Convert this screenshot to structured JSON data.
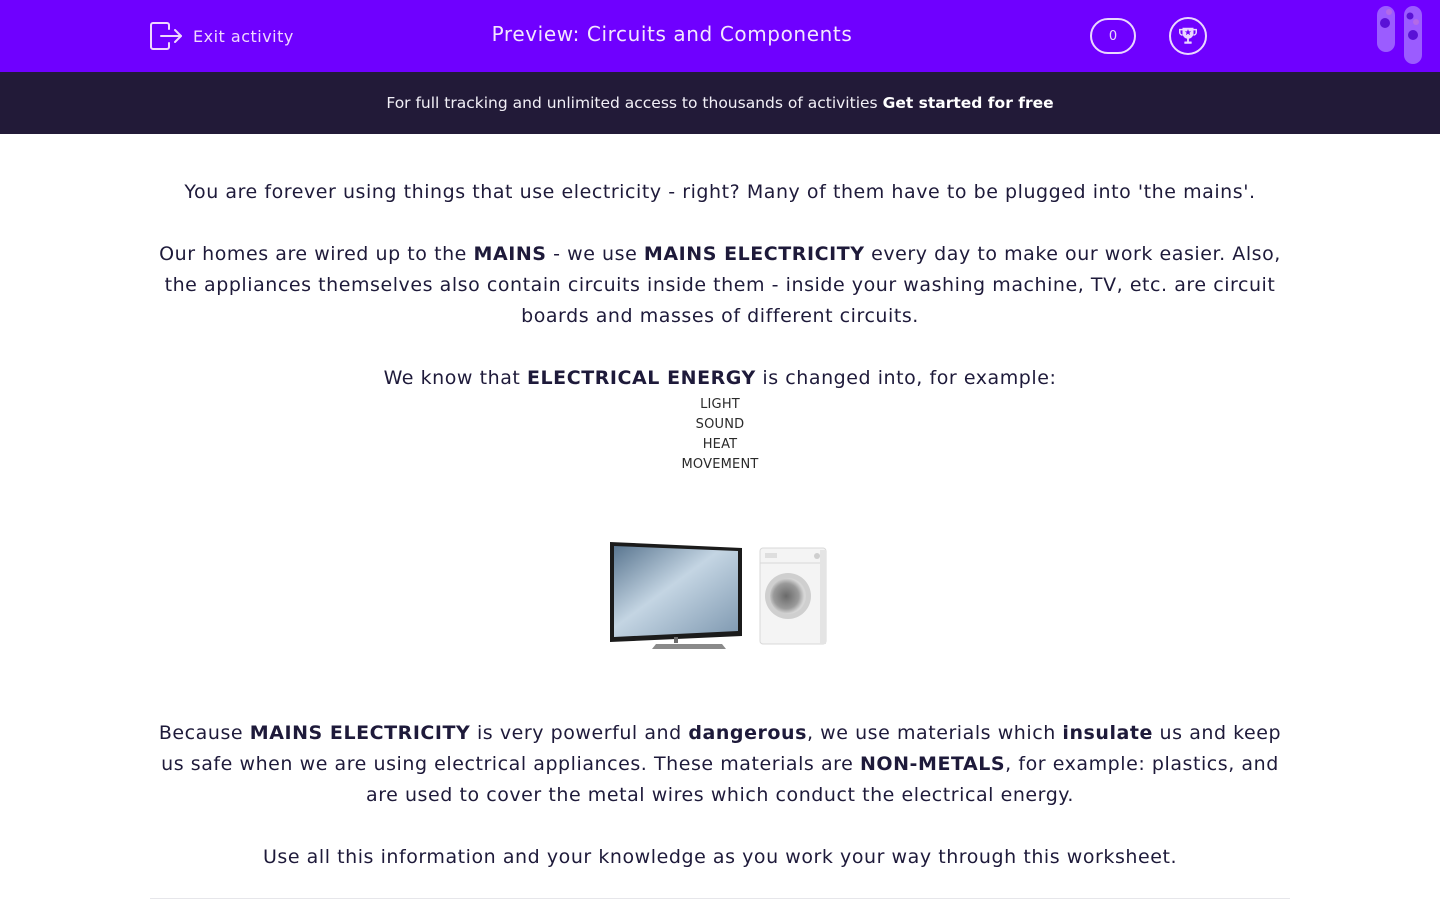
{
  "header": {
    "exit_label": "Exit activity",
    "exit_icon": "exit-icon",
    "title": "Preview: Circuits and Components",
    "score": "0",
    "trophy_icon": "trophy-icon",
    "logo_icon": "test-tubes-logo-icon",
    "bg_color": "#6f00ff"
  },
  "banner": {
    "text": "For full tracking and unlimited access to thousands of activities",
    "cta": "Get started for free",
    "bg_color": "#221a38"
  },
  "content": {
    "p1": "You are forever using things that use electricity - right?  Many of them have to be plugged into 'the mains'.",
    "p2": {
      "a": "Our homes are wired up to the ",
      "b1": "MAINS",
      "c": " - we use ",
      "b2": "MAINS ELECTRICITY",
      "d": " every day to make our work easier. Also, the appliances themselves also contain circuits inside them - inside your washing machine, TV, etc. are circuit boards and masses of different circuits."
    },
    "p3": {
      "a": "We know that ",
      "b1": "ELECTRICAL ENERGY",
      "c": " is changed into, for example:"
    },
    "energy_list": [
      "LIGHT",
      "SOUND",
      "HEAT",
      "MOVEMENT"
    ],
    "image_alt": "Flat screen TV and washing machine",
    "p4": {
      "a": "Because ",
      "b1": "MAINS ELECTRICITY",
      "c": " is very powerful and ",
      "b2": "dangerous",
      "d": ", we use materials which ",
      "b3": "insulate",
      "e": " us and keep us safe when we are using electrical appliances. These materials are ",
      "b4": "NON-METALS",
      "f": ", for example: plastics, and are used to cover the metal wires which conduct the electrical energy."
    },
    "p5": "Use all this information and your knowledge as you work your way through this worksheet."
  }
}
